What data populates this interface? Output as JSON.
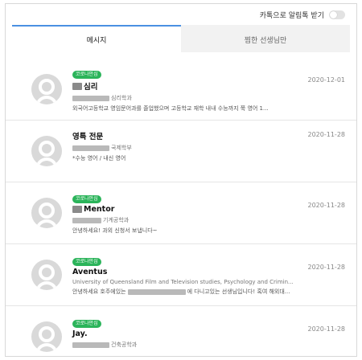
{
  "topbar": {
    "kakao_label": "카톡으로 알림톡 받기"
  },
  "tabs": [
    {
      "label": "메시지"
    },
    {
      "label": "찜한 선생님만"
    }
  ],
  "badge_label": "코로나안심",
  "messages": [
    {
      "name": "심리",
      "dept": "심리학과",
      "preview": "외국어고등학교 영임문어과를 졸업했으며 고등학교 재학 내내 수능까지 쭉 영어 1...",
      "date": "2020-12-01",
      "badge": true
    },
    {
      "name": "영특 전문",
      "dept": "국제학부",
      "preview": "*수능 영어 / 내신 영어",
      "date": "2020-11-28",
      "badge": false
    },
    {
      "name": "Mentor",
      "dept": "기계공학과",
      "preview": "안녕하세요! 과외 신청서 보냅니다~",
      "date": "2020-11-28",
      "badge": true
    },
    {
      "name": "Aventus",
      "dept": "University of Queensland Film and Television studies, Psychology and Crimin...",
      "preview_before": "안녕하세요 호주에있는",
      "preview_after": "에 다니고있는 선생님입니다! 혹여 해외대...",
      "date": "2020-11-28",
      "badge": true
    },
    {
      "name": "Jay.",
      "dept": "건축공학과",
      "date": "2020-11-28",
      "badge": true
    }
  ]
}
